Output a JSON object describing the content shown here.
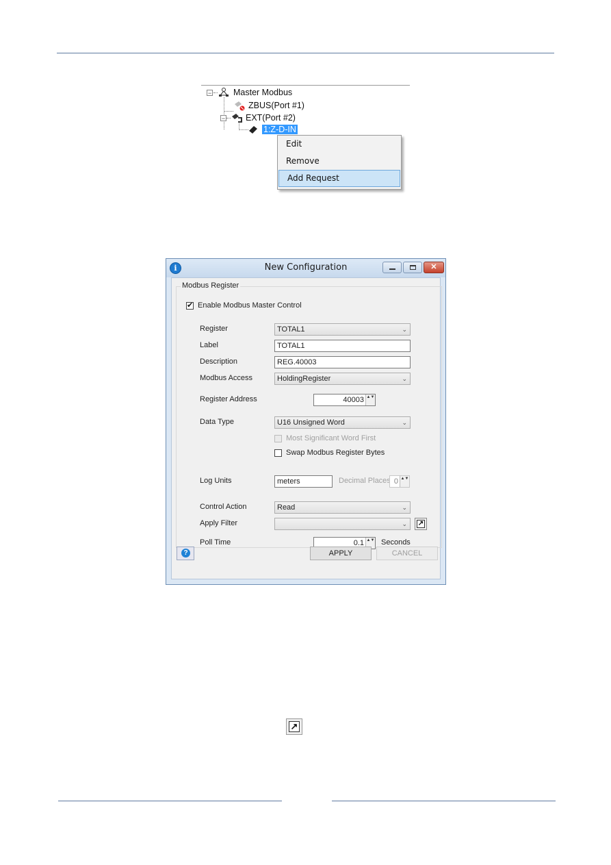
{
  "page": {
    "colors": {
      "rule": "#5f7aa0",
      "selection": "#3399ff",
      "menu_highlight": "#cce4f7"
    }
  },
  "tree": {
    "root": {
      "label": "Master Modbus",
      "icon": "network-icon",
      "expander": "minus"
    },
    "children": [
      {
        "label": "ZBUS(Port #1)",
        "icon": "port-disabled-icon"
      },
      {
        "label": "EXT(Port #2)",
        "icon": "port-icon",
        "expander": "minus",
        "children": [
          {
            "label": "1:Z-D-IN",
            "icon": "device-icon",
            "selected": true
          }
        ]
      }
    ],
    "expander_glyph": "−"
  },
  "context_menu": {
    "items": [
      {
        "label": "Edit"
      },
      {
        "label": "Remove"
      },
      {
        "label": "Add Request",
        "highlighted": true
      }
    ]
  },
  "dialog": {
    "title": "New Configuration",
    "app_icon_glyph": "i",
    "close_glyph": "✕",
    "group_title": "Modbus Register",
    "enable": {
      "label": "Enable Modbus Master Control",
      "checked": true,
      "glyph": "✔"
    },
    "fields": {
      "register": {
        "label": "Register",
        "value": "TOTAL1"
      },
      "label": {
        "label": "Label",
        "value": "TOTAL1"
      },
      "description": {
        "label": "Description",
        "value": "REG.40003"
      },
      "modbus_access": {
        "label": "Modbus Access",
        "value": "HoldingRegister"
      },
      "register_address": {
        "label": "Register Address",
        "value": "40003"
      },
      "data_type": {
        "label": "Data Type",
        "value": "U16 Unsigned Word"
      },
      "msw_first": {
        "label": "Most Significant Word First",
        "checked": false,
        "disabled": true
      },
      "swap_bytes": {
        "label": "Swap Modbus Register Bytes",
        "checked": false
      },
      "log_units": {
        "label": "Log Units",
        "value": "meters"
      },
      "decimal_places": {
        "label": "Decimal Places",
        "value": "0",
        "disabled": true
      },
      "control_action": {
        "label": "Control Action",
        "value": "Read"
      },
      "apply_filter": {
        "label": "Apply Filter",
        "value": ""
      },
      "poll_time": {
        "label": "Poll Time",
        "value": "0.1",
        "unit": "Seconds"
      }
    },
    "dropdown_arrow": "⌄",
    "spin_glyph": "▲▼",
    "popout_glyph": "↗",
    "help_glyph": "?",
    "buttons": {
      "apply": "APPLY",
      "cancel": "CANCEL"
    }
  },
  "standalone_icon": {
    "name": "popout-icon",
    "glyph": "↗"
  }
}
